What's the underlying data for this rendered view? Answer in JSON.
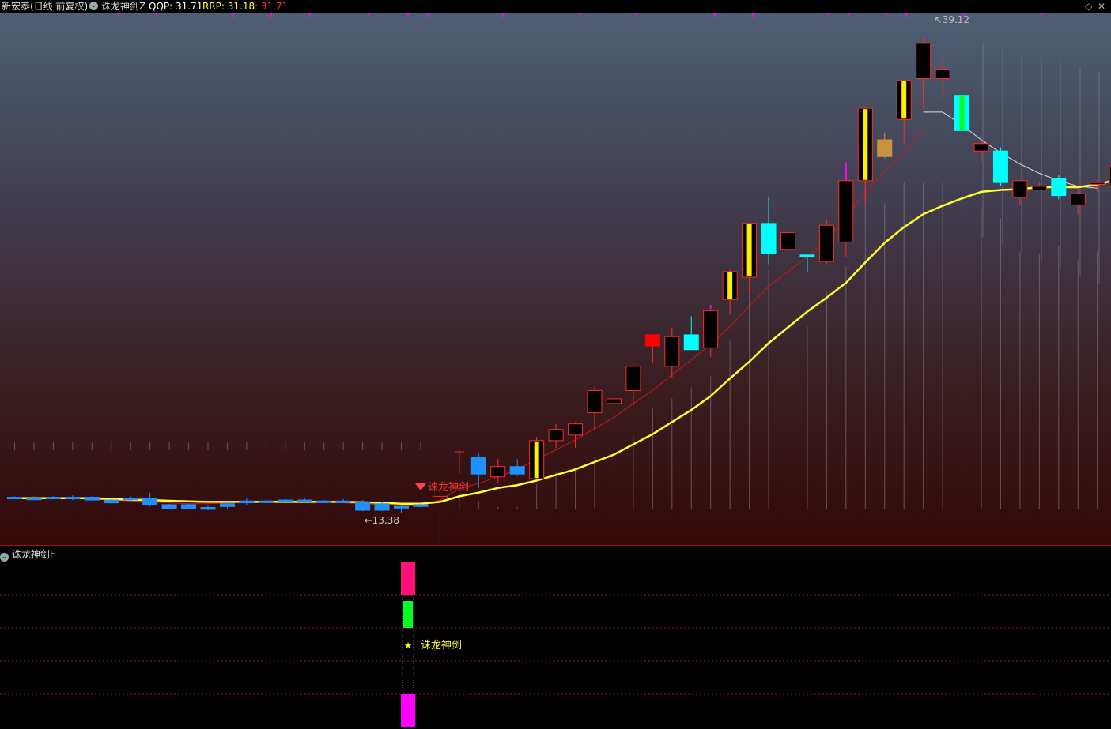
{
  "header": {
    "stock": "新宏泰(日线 前复权)",
    "indicator": "诛龙神剑Z",
    "qqp_label": "QQP: 31.71",
    "rrp_label": "RRP: 31.18",
    "last_label": ": 31.71"
  },
  "sub": {
    "title": "诛龙神剑F",
    "signal_label": "诛龙神剑"
  },
  "colors": {
    "up": "#ff2a2a",
    "down": "#00ffff",
    "down_small": "#1e90ff",
    "ma_yellow": "#ffff33",
    "ma_red": "#d01818",
    "ma_white": "#e0e0e0",
    "pink": "#ff1177",
    "green": "#00ff22",
    "magenta": "#ff00ff"
  },
  "chart_data": {
    "type": "candlestick",
    "ylim": [
      12.9,
      40.0
    ],
    "annotations": {
      "high_label": "39.12",
      "low_label": "13.38",
      "signal_label": "诛龙神剑"
    },
    "candles": [
      {
        "o": 14.25,
        "h": 14.3,
        "l": 14.15,
        "c": 14.2,
        "k": "flat"
      },
      {
        "o": 14.2,
        "h": 14.3,
        "l": 14.1,
        "c": 14.2,
        "k": "flat"
      },
      {
        "o": 14.2,
        "h": 14.3,
        "l": 14.15,
        "c": 14.25,
        "k": "flat"
      },
      {
        "o": 14.2,
        "h": 14.35,
        "l": 14.1,
        "c": 14.25,
        "k": "flat"
      },
      {
        "o": 14.25,
        "h": 14.3,
        "l": 14.1,
        "c": 14.1,
        "k": "dsm"
      },
      {
        "o": 14.1,
        "h": 14.2,
        "l": 13.9,
        "c": 13.95,
        "k": "dsm"
      },
      {
        "o": 14.2,
        "h": 14.3,
        "l": 14.0,
        "c": 14.15,
        "k": "dsm"
      },
      {
        "o": 14.2,
        "h": 14.5,
        "l": 13.75,
        "c": 13.85,
        "k": "dsm"
      },
      {
        "o": 13.85,
        "h": 13.9,
        "l": 13.6,
        "c": 13.65,
        "k": "dsm"
      },
      {
        "o": 13.85,
        "h": 13.9,
        "l": 13.6,
        "c": 13.65,
        "k": "dsm"
      },
      {
        "o": 13.7,
        "h": 13.8,
        "l": 13.55,
        "c": 13.6,
        "k": "dsm"
      },
      {
        "o": 13.9,
        "h": 14.0,
        "l": 13.65,
        "c": 13.75,
        "k": "dsm"
      },
      {
        "o": 14.05,
        "h": 14.2,
        "l": 13.85,
        "c": 13.95,
        "k": "dsm"
      },
      {
        "o": 14.05,
        "h": 14.15,
        "l": 13.9,
        "c": 14.0,
        "k": "dsm"
      },
      {
        "o": 14.1,
        "h": 14.25,
        "l": 14.0,
        "c": 14.1,
        "k": "flat"
      },
      {
        "o": 14.1,
        "h": 14.2,
        "l": 14.0,
        "c": 14.05,
        "k": "flat"
      },
      {
        "o": 14.05,
        "h": 14.1,
        "l": 13.95,
        "c": 14.05,
        "k": "flat"
      },
      {
        "o": 14.05,
        "h": 14.15,
        "l": 13.95,
        "c": 14.0,
        "k": "dsm"
      },
      {
        "o": 14.0,
        "h": 14.1,
        "l": 13.5,
        "c": 13.55,
        "k": "dsm"
      },
      {
        "o": 13.9,
        "h": 14.0,
        "l": 13.5,
        "c": 13.55,
        "k": "dsm"
      },
      {
        "o": 13.75,
        "h": 13.85,
        "l": 13.38,
        "c": 13.7,
        "k": "dsm"
      },
      {
        "o": 13.85,
        "h": 13.9,
        "l": 13.7,
        "c": 13.75,
        "k": "dsm"
      },
      {
        "o": 14.25,
        "h": 14.3,
        "l": 14.15,
        "c": 14.3,
        "k": "up"
      },
      {
        "o": 16.5,
        "h": 16.75,
        "l": 15.5,
        "c": 16.7,
        "k": "uplin"
      },
      {
        "o": 16.4,
        "h": 16.6,
        "l": 14.75,
        "c": 15.5,
        "k": "dbl"
      },
      {
        "o": 15.35,
        "h": 16.3,
        "l": 15.0,
        "c": 15.9,
        "k": "up"
      },
      {
        "o": 15.9,
        "h": 16.3,
        "l": 15.4,
        "c": 15.5,
        "k": "dbl"
      },
      {
        "o": 15.25,
        "h": 17.5,
        "l": 15.2,
        "c": 17.3,
        "k": "ybar"
      },
      {
        "o": 17.3,
        "h": 18.2,
        "l": 16.9,
        "c": 17.9,
        "k": "up"
      },
      {
        "o": 17.6,
        "h": 18.3,
        "l": 16.9,
        "c": 18.2,
        "k": "up"
      },
      {
        "o": 18.8,
        "h": 20.2,
        "l": 17.9,
        "c": 20.0,
        "k": "up",
        "mh": 20.2
      },
      {
        "o": 19.3,
        "h": 20.0,
        "l": 19.0,
        "c": 19.55,
        "k": "up"
      },
      {
        "o": 20.0,
        "h": 21.4,
        "l": 19.2,
        "c": 21.3,
        "k": "up"
      },
      {
        "o": 22.4,
        "h": 22.9,
        "l": 21.5,
        "c": 23.0,
        "k": "rsol"
      },
      {
        "o": 21.3,
        "h": 23.4,
        "l": 20.7,
        "c": 22.9,
        "k": "up"
      },
      {
        "o": 23.0,
        "h": 24.0,
        "l": 22.2,
        "c": 22.2,
        "k": "dcy"
      },
      {
        "o": 22.3,
        "h": 24.6,
        "l": 21.8,
        "c": 24.3,
        "k": "up",
        "mh": 24.45
      },
      {
        "o": 24.9,
        "h": 26.5,
        "l": 24.1,
        "c": 26.4,
        "k": "ybar"
      },
      {
        "o": 26.1,
        "h": 29.0,
        "l": 25.2,
        "c": 29.0,
        "k": "ybar"
      },
      {
        "o": 29.0,
        "h": 30.4,
        "l": 26.8,
        "c": 27.4,
        "k": "dcy"
      },
      {
        "o": 27.6,
        "h": 28.5,
        "l": 27.0,
        "c": 28.5,
        "k": "up"
      },
      {
        "o": 27.3,
        "h": 27.3,
        "l": 26.4,
        "c": 27.3,
        "k": "dcy"
      },
      {
        "o": 26.95,
        "h": 29.2,
        "l": 26.8,
        "c": 28.9,
        "k": "up"
      },
      {
        "o": 28.0,
        "h": 30.5,
        "l": 27.2,
        "c": 31.3,
        "k": "up",
        "mh": 32.3
      },
      {
        "o": 31.3,
        "h": 35.3,
        "l": 30.0,
        "c": 35.2,
        "k": "ybar"
      },
      {
        "o": 33.5,
        "h": 33.9,
        "l": 32.5,
        "c": 32.6,
        "k": "dorg"
      },
      {
        "o": 34.6,
        "h": 36.7,
        "l": 33.3,
        "c": 36.7,
        "k": "ybar"
      },
      {
        "o": 36.8,
        "h": 39.12,
        "l": 35.2,
        "c": 38.7,
        "k": "up",
        "mh": 39.12
      },
      {
        "o": 37.3,
        "h": 38.0,
        "l": 35.8,
        "c": 36.8,
        "k": "up"
      },
      {
        "o": 35.9,
        "h": 36.0,
        "l": 34.0,
        "c": 34.0,
        "k": "dcyg"
      },
      {
        "o": 32.9,
        "h": 33.6,
        "l": 32.3,
        "c": 33.3,
        "k": "up"
      },
      {
        "o": 32.9,
        "h": 33.1,
        "l": 31.0,
        "c": 31.2,
        "k": "dcy"
      },
      {
        "o": 30.4,
        "h": 31.3,
        "l": 30.0,
        "c": 31.3,
        "k": "up"
      },
      {
        "o": 31.0,
        "h": 31.2,
        "l": 30.9,
        "c": 30.8,
        "k": "up"
      },
      {
        "o": 31.4,
        "h": 31.6,
        "l": 30.3,
        "c": 30.5,
        "k": "dcy"
      },
      {
        "o": 30.6,
        "h": 30.9,
        "l": 29.5,
        "c": 30.0,
        "k": "up"
      },
      {
        "o": 31.1,
        "h": 31.3,
        "l": 30.7,
        "c": 31.2,
        "k": "up"
      },
      {
        "o": 31.0,
        "h": 32.1,
        "l": 30.7,
        "c": 32.1,
        "k": "up"
      },
      {
        "o": 31.7,
        "h": 32.0,
        "l": 31.0,
        "c": 32.0,
        "k": "up"
      }
    ],
    "ma_yellow": [
      14.2,
      14.2,
      14.2,
      14.2,
      14.2,
      14.15,
      14.12,
      14.1,
      14.06,
      14.03,
      14.0,
      14.0,
      14.0,
      14.0,
      14.0,
      14.0,
      14.0,
      14.0,
      13.98,
      13.95,
      13.9,
      13.9,
      14.0,
      14.3,
      14.5,
      14.75,
      14.9,
      15.15,
      15.45,
      15.75,
      16.15,
      16.55,
      17.1,
      17.65,
      18.3,
      18.95,
      19.7,
      20.65,
      21.55,
      22.55,
      23.4,
      24.25,
      25.0,
      25.8,
      26.9,
      27.95,
      28.8,
      29.5,
      29.95,
      30.35,
      30.7,
      30.8,
      30.85,
      30.95,
      30.95,
      30.95,
      31.1,
      31.35,
      31.6
    ],
    "ma_red": [
      14.2,
      14.2,
      14.2,
      14.2,
      14.15,
      14.1,
      14.05,
      14.0,
      13.95,
      13.9,
      13.9,
      13.95,
      14.0,
      14.05,
      14.05,
      14.05,
      14.0,
      13.95,
      13.9,
      13.85,
      13.8,
      13.8,
      14.1,
      14.7,
      15.0,
      15.35,
      15.75,
      16.3,
      16.8,
      17.35,
      17.95,
      18.55,
      19.3,
      20.0,
      20.85,
      21.65,
      22.5,
      23.45,
      24.55,
      25.6,
      26.4,
      27.2,
      28.1,
      29.3,
      30.7,
      31.8,
      32.9,
      34.0
    ],
    "ma_white": [
      {
        "i": 47,
        "v": 35.0
      },
      {
        "i": 48,
        "v": 35.0
      },
      {
        "i": 49,
        "v": 34.3
      },
      {
        "i": 50,
        "v": 33.5
      },
      {
        "i": 51,
        "v": 32.8
      },
      {
        "i": 52,
        "v": 32.2
      },
      {
        "i": 53,
        "v": 31.7
      },
      {
        "i": 54,
        "v": 31.3
      },
      {
        "i": 55,
        "v": 31.0
      },
      {
        "i": 56,
        "v": 30.9
      }
    ]
  }
}
